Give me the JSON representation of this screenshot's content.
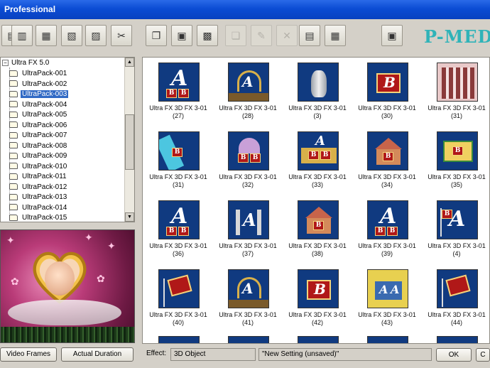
{
  "window": {
    "title": "Professional"
  },
  "brand": "P-MEDI",
  "toolbar": {
    "buttons": [
      {
        "name": "new-project-button",
        "icon": "folder-open-icon",
        "glyph": "▤",
        "disabled": false
      },
      {
        "name": "open-button",
        "icon": "folder-icon",
        "glyph": "▥",
        "disabled": false
      },
      {
        "name": "save-button",
        "icon": "disk-icon",
        "glyph": "▦",
        "disabled": false
      },
      {
        "name": "save-as-button",
        "icon": "disks-icon",
        "glyph": "▧",
        "disabled": false
      },
      {
        "name": "export-button",
        "icon": "export-icon",
        "glyph": "▨",
        "disabled": false
      },
      {
        "name": "cut-button",
        "icon": "scissors-icon",
        "glyph": "✂",
        "disabled": false
      },
      {
        "name": "copy-button",
        "icon": "copy-icon",
        "glyph": "❐",
        "disabled": false
      },
      {
        "name": "paste-button",
        "icon": "paste-icon",
        "glyph": "▣",
        "disabled": false
      },
      {
        "name": "duplicate-button",
        "icon": "duplicate-icon",
        "glyph": "▩",
        "disabled": false
      },
      {
        "name": "clone-button",
        "icon": "clone-icon",
        "glyph": "❏",
        "disabled": true
      },
      {
        "name": "rename-button",
        "icon": "rename-icon",
        "glyph": "✎",
        "disabled": true
      },
      {
        "name": "delete-button",
        "icon": "x-icon",
        "glyph": "✕",
        "disabled": true
      },
      {
        "name": "import-button",
        "icon": "import-icon",
        "glyph": "▤",
        "disabled": false
      },
      {
        "name": "properties-button",
        "icon": "properties-icon",
        "glyph": "▦",
        "disabled": false
      },
      {
        "name": "preview-button",
        "icon": "monitor-icon",
        "glyph": "▣",
        "disabled": false
      }
    ]
  },
  "tree": {
    "root": "Ultra FX 5.0",
    "items": [
      {
        "label": "UltraPack-001",
        "selected": false
      },
      {
        "label": "UltraPack-002",
        "selected": false
      },
      {
        "label": "UltraPack-003",
        "selected": true
      },
      {
        "label": "UltraPack-004",
        "selected": false
      },
      {
        "label": "UltraPack-005",
        "selected": false
      },
      {
        "label": "UltraPack-006",
        "selected": false
      },
      {
        "label": "UltraPack-007",
        "selected": false
      },
      {
        "label": "UltraPack-008",
        "selected": false
      },
      {
        "label": "UltraPack-009",
        "selected": false
      },
      {
        "label": "UltraPack-010",
        "selected": false
      },
      {
        "label": "UltraPack-011",
        "selected": false
      },
      {
        "label": "UltraPack-012",
        "selected": false
      },
      {
        "label": "UltraPack-013",
        "selected": false
      },
      {
        "label": "UltraPack-014",
        "selected": false
      },
      {
        "label": "UltraPack-015",
        "selected": false
      }
    ]
  },
  "buttons": {
    "video_frames": "Video Frames",
    "actual_duration": "Actual Duration"
  },
  "effects": {
    "caption_prefix": "Ultra FX 3D FX 3-01",
    "items": [
      {
        "num": "(27)",
        "style": "ab"
      },
      {
        "num": "(28)",
        "style": "arch"
      },
      {
        "num": "(3)",
        "style": "vase"
      },
      {
        "num": "(30)",
        "style": "book"
      },
      {
        "num": "(31)",
        "style": "building"
      },
      {
        "num": "(31)",
        "style": "tube"
      },
      {
        "num": "(32)",
        "style": "dome"
      },
      {
        "num": "(33)",
        "style": "gate"
      },
      {
        "num": "(34)",
        "style": "house"
      },
      {
        "num": "(35)",
        "style": "gold"
      },
      {
        "num": "(36)",
        "style": "ab"
      },
      {
        "num": "(37)",
        "style": "spires"
      },
      {
        "num": "(38)",
        "style": "house"
      },
      {
        "num": "(39)",
        "style": "ab"
      },
      {
        "num": "(4)",
        "style": "aflag"
      },
      {
        "num": "(40)",
        "style": "flag"
      },
      {
        "num": "(41)",
        "style": "arch"
      },
      {
        "num": "(42)",
        "style": "book"
      },
      {
        "num": "(43)",
        "style": "yellow"
      },
      {
        "num": "(44)",
        "style": "flag"
      }
    ]
  },
  "status": {
    "label": "Effect:",
    "value": "3D Object",
    "setting": "\"New Setting (unsaved)\"",
    "ok": "OK",
    "last": "C"
  },
  "colors": {
    "title_blue": "#0b4cd4",
    "thumb_blue": "#103a80",
    "selection": "#316ac5",
    "brand_teal": "#2fb3b8"
  }
}
